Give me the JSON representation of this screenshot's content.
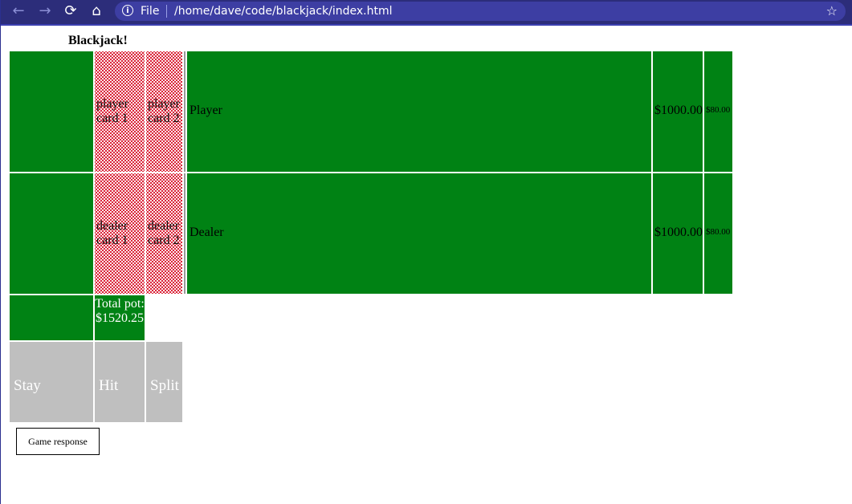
{
  "browser": {
    "scheme_label": "File",
    "url": "/home/dave/code/blackjack/index.html"
  },
  "page": {
    "title": "Blackjack!"
  },
  "table": {
    "player": {
      "cards": [
        "player card 1",
        "player card 2"
      ],
      "name": "Player",
      "bank": "$1000.00",
      "bet": "$80.00"
    },
    "dealer": {
      "cards": [
        "dealer card 1",
        "dealer card 2"
      ],
      "name": "Dealer",
      "bank": "$1000.00",
      "bet": "$80.00"
    },
    "pot_label": "Total pot: $1520.25"
  },
  "controls": {
    "stay": "Stay",
    "hit": "Hit",
    "split": "Split",
    "response": "Game response"
  },
  "colors": {
    "felt": "#008214",
    "card_back": "#d91e33",
    "button": "#bfbfbf"
  }
}
